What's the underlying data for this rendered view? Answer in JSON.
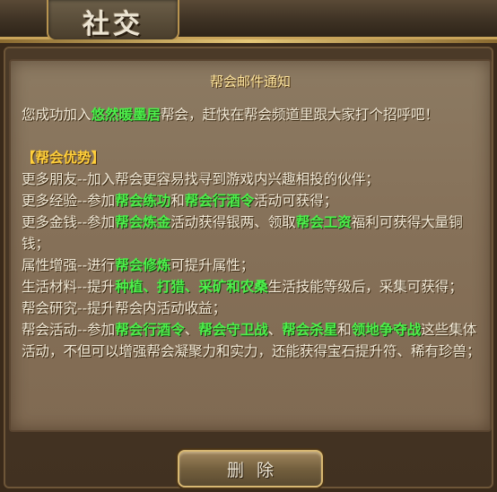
{
  "window": {
    "title": "社交"
  },
  "mail": {
    "title": "帮会邮件通知",
    "intro": [
      {
        "t": "您成功加入"
      },
      {
        "t": "悠然暖墨居",
        "hl": true
      },
      {
        "t": "帮会，赶快在帮会频道里跟大家打个招呼吧！"
      }
    ],
    "section_title": "【帮会优势】",
    "lines": [
      [
        {
          "t": "更多朋友--加入帮会更容易找寻到游戏内兴趣相投的伙伴；"
        }
      ],
      [
        {
          "t": "更多经验--参加"
        },
        {
          "t": "帮会练功",
          "hl": true
        },
        {
          "t": "和"
        },
        {
          "t": "帮会行酒令",
          "hl": true
        },
        {
          "t": "活动可获得；"
        }
      ],
      [
        {
          "t": "更多金钱--参加"
        },
        {
          "t": "帮会炼金",
          "hl": true
        },
        {
          "t": "活动获得银两、领取"
        },
        {
          "t": "帮会工资",
          "hl": true
        },
        {
          "t": "福利可获得大量铜钱；"
        }
      ],
      [
        {
          "t": "属性增强--进行"
        },
        {
          "t": "帮会修炼",
          "hl": true
        },
        {
          "t": "可提升属性；"
        }
      ],
      [
        {
          "t": "生活材料--提升"
        },
        {
          "t": "种植、打猎、采矿和农桑",
          "hl": true
        },
        {
          "t": "生活技能等级后，采集可获得；"
        }
      ],
      [
        {
          "t": "帮会研究--提升帮会内活动收益；"
        }
      ],
      [
        {
          "t": "帮会活动--参加"
        },
        {
          "t": "帮会行酒令",
          "hl": true
        },
        {
          "t": "、"
        },
        {
          "t": "帮会守卫战",
          "hl": true
        },
        {
          "t": "、"
        },
        {
          "t": "帮会杀星",
          "hl": true
        },
        {
          "t": "和"
        },
        {
          "t": "领地争夺战",
          "hl": true
        },
        {
          "t": "这些集体活动，不但可以增强帮会凝聚力和实力，还能获得宝石提升符、稀有珍兽；"
        }
      ]
    ]
  },
  "buttons": {
    "delete_label": "删除"
  },
  "colors": {
    "highlight": "#4cf04a",
    "section": "#ffcf3a",
    "text": "#f2ead8",
    "title": "#ffe7a0"
  }
}
